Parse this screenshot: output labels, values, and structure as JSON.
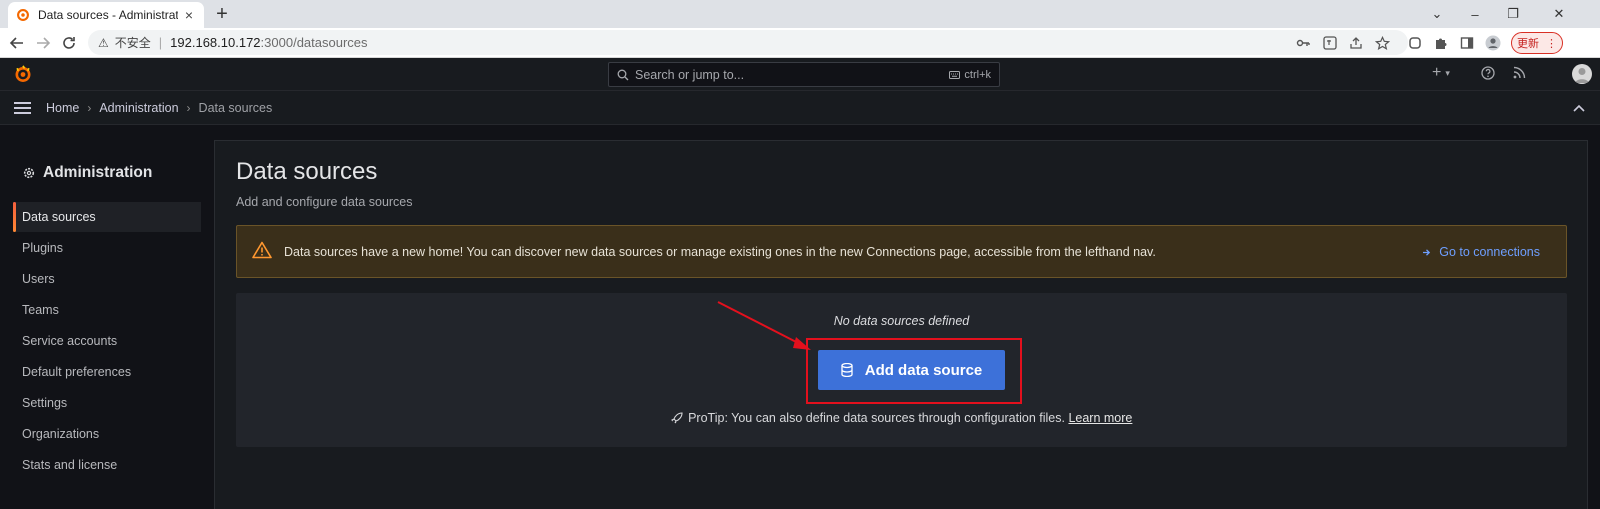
{
  "browser": {
    "tab_title": "Data sources - Administration",
    "tab_close": "×",
    "new_tab": "+",
    "window_controls": [
      "⌄",
      "–",
      "❐",
      "✕"
    ],
    "insecure_label": "不安全",
    "url_host": "192.168.10.172",
    "url_path": ":3000/datasources",
    "update_label": "更新"
  },
  "topbar": {
    "search_placeholder": "Search or jump to...",
    "search_shortcut": "ctrl+k",
    "add_label": "+"
  },
  "breadcrumbs": {
    "home": "Home",
    "administration": "Administration",
    "current": "Data sources",
    "chevron": "›"
  },
  "sidebar": {
    "title": "Administration",
    "items": [
      {
        "label": "Data sources",
        "active": true
      },
      {
        "label": "Plugins"
      },
      {
        "label": "Users"
      },
      {
        "label": "Teams"
      },
      {
        "label": "Service accounts"
      },
      {
        "label": "Default preferences"
      },
      {
        "label": "Settings"
      },
      {
        "label": "Organizations"
      },
      {
        "label": "Stats and license"
      }
    ]
  },
  "main": {
    "title": "Data sources",
    "subtitle": "Add and configure data sources",
    "alert_message": "Data sources have a new home! You can discover new data sources or manage existing ones in the new Connections page, accessible from the lefthand nav.",
    "alert_link": "Go to connections",
    "empty_text": "No data sources defined",
    "add_button": "Add data source",
    "protip_text": "ProTip: You can also define data sources through configuration files.",
    "protip_link": "Learn more"
  },
  "colors": {
    "primary_button": "#3d71d9",
    "warning_bg": "#3a2f1a",
    "highlight_annotation": "#e3101d",
    "active_accent": "#ff8833"
  }
}
